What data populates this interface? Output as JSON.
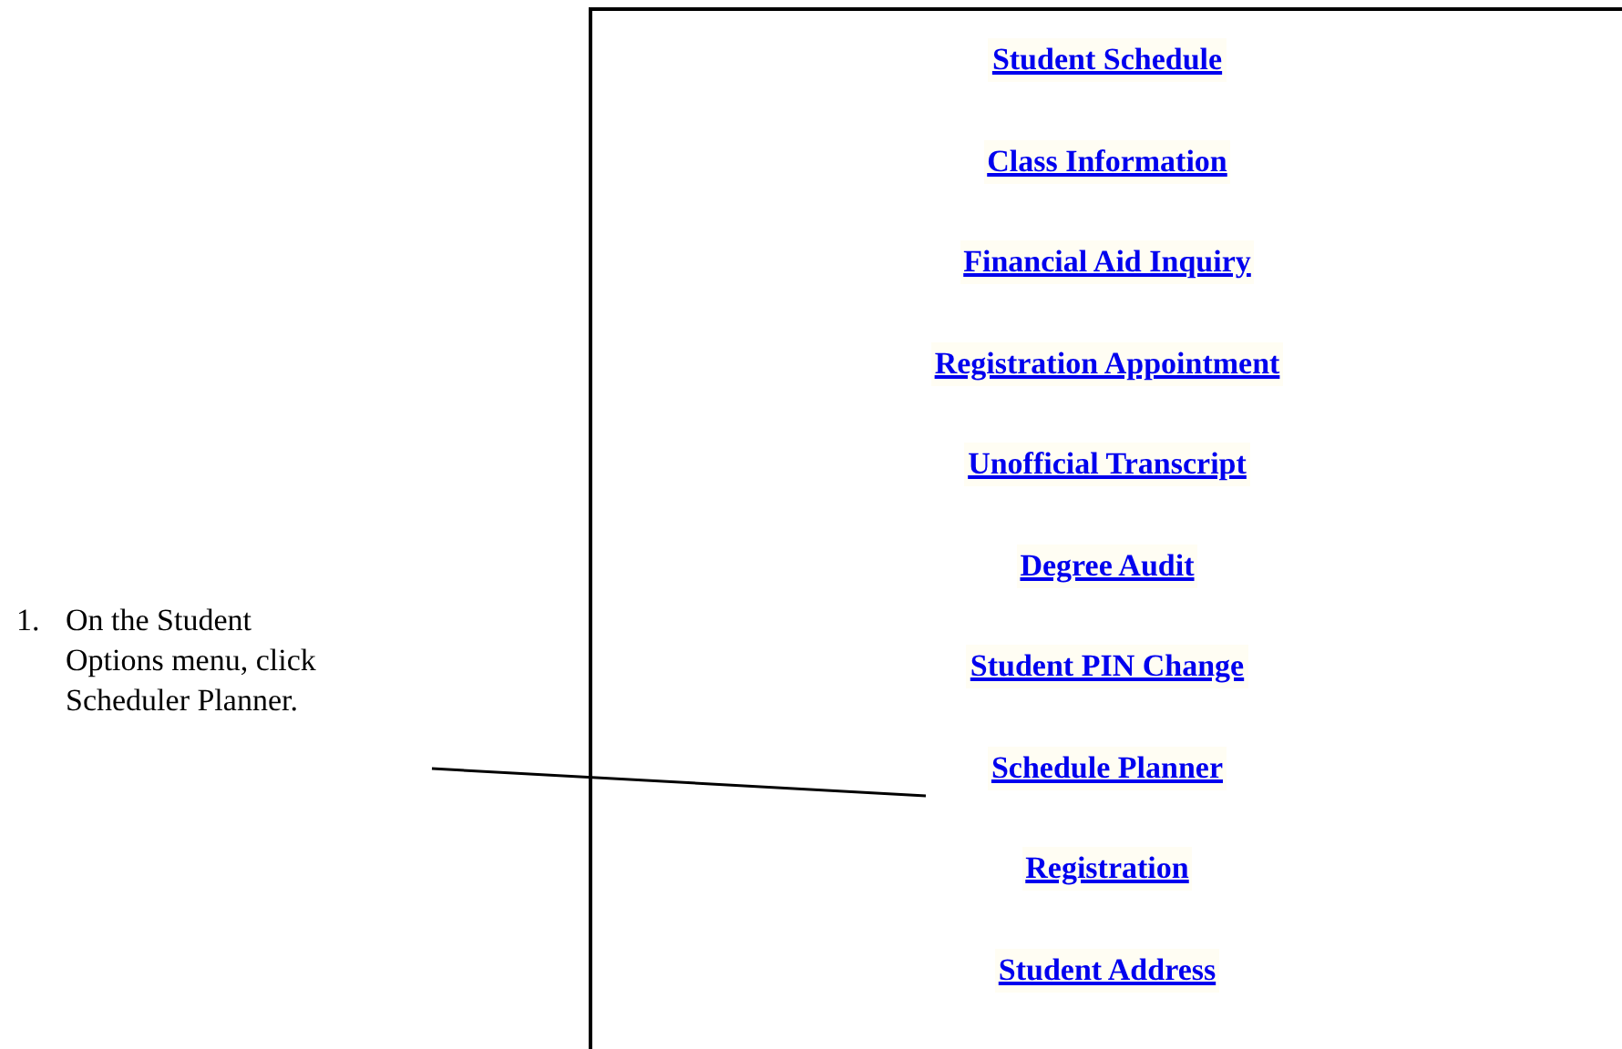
{
  "step": {
    "number": "1.",
    "text": "On the Student Options menu, click Scheduler Planner."
  },
  "menu": {
    "links": [
      {
        "label": "Student Schedule"
      },
      {
        "label": "Class Information"
      },
      {
        "label": "Financial Aid Inquiry"
      },
      {
        "label": "Registration Appointment"
      },
      {
        "label": "Unofficial Transcript"
      },
      {
        "label": "Degree Audit"
      },
      {
        "label": "Student PIN Change"
      },
      {
        "label": "Schedule Planner"
      },
      {
        "label": "Registration"
      },
      {
        "label": "Student Address"
      }
    ]
  }
}
